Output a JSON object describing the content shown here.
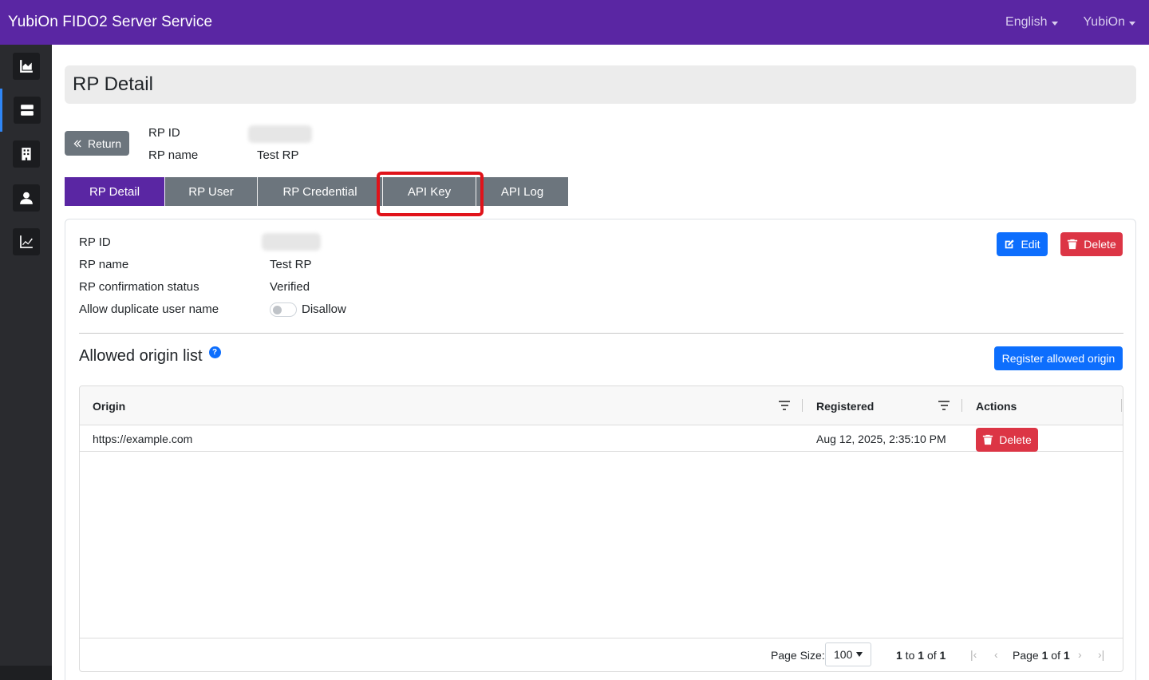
{
  "app": {
    "title": "YubiOn FIDO2 Server Service"
  },
  "header": {
    "language": "English",
    "user": "YubiOn"
  },
  "sidebar": {
    "items": [
      {
        "icon": "area-chart-icon"
      },
      {
        "icon": "server-icon",
        "active": true
      },
      {
        "icon": "building-icon"
      },
      {
        "icon": "user-icon"
      },
      {
        "icon": "line-chart-icon"
      }
    ]
  },
  "page": {
    "title": "RP Detail",
    "return_label": "Return",
    "rp_id_label": "RP ID",
    "rp_name_label": "RP name",
    "rp_name_value": "Test RP"
  },
  "tabs": [
    {
      "label": "RP Detail",
      "active": true
    },
    {
      "label": "RP User"
    },
    {
      "label": "RP Credential"
    },
    {
      "label": "API Key",
      "highlighted": true
    },
    {
      "label": "API Log"
    }
  ],
  "details": {
    "rp_id_label": "RP ID",
    "rp_name_label": "RP name",
    "rp_name_value": "Test RP",
    "confirmation_label": "RP confirmation status",
    "confirmation_value": "Verified",
    "duplicate_label": "Allow duplicate user name",
    "duplicate_value": "Disallow",
    "edit_label": "Edit",
    "delete_label": "Delete"
  },
  "origins": {
    "title": "Allowed origin list",
    "help_glyph": "?",
    "register_label": "Register allowed origin",
    "columns": [
      "Origin",
      "Registered",
      "Actions"
    ],
    "rows": [
      {
        "origin": "https://example.com",
        "registered": "Aug 12, 2025, 2:35:10 PM",
        "action": "Delete"
      }
    ],
    "footer": {
      "page_size_label": "Page Size:",
      "page_size": "100",
      "range_from": "1",
      "range_to_text": " to ",
      "range_to": "1",
      "range_of_text": " of ",
      "range_total": "1",
      "page_text": "Page ",
      "page_current": "1",
      "page_of_text": " of ",
      "page_total": "1",
      "first_glyph": "|‹",
      "prev_glyph": "‹",
      "next_glyph": "›",
      "last_glyph": "›|"
    }
  },
  "colors": {
    "navbar": "#5a26a3",
    "sidebar": "#2a2b2f",
    "primary": "#0d6efd",
    "danger": "#dc3545",
    "highlight": "#e0131a"
  }
}
